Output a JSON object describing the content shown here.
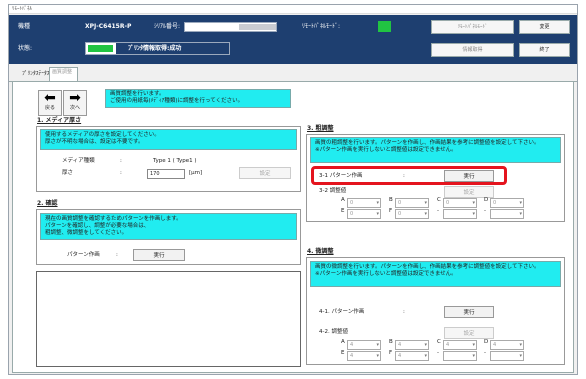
{
  "window": {
    "title": "ﾘﾓｰﾄﾊﾟﾈﾙ"
  },
  "header": {
    "model_label": "機種",
    "model_value": "XPJ-C6415R-P",
    "serial_label": "ｼﾘｱﾙ番号:",
    "remote_label": "ﾘﾓｰﾄﾊﾟﾈﾙﾓｰﾄﾞ:",
    "status_label": "状態:",
    "status_value": "ﾌﾟﾘﾝﾀ情報取得:成功",
    "remote_mode_button": "ﾘﾓｰﾄﾊﾟﾈﾙﾓｰﾄﾞ",
    "change_button": "変更",
    "info_button": "情報取得",
    "exit_button": "終了"
  },
  "tabs": [
    {
      "label": "ﾌﾟﾘﾝﾀｽﾃｰﾀｽ"
    },
    {
      "label": "画質調整"
    }
  ],
  "intro": {
    "line1": "画質調整を行います。",
    "line2": "ご使用の用紙毎(ﾒﾃﾞｨｱ種類)に調整を行ってください。"
  },
  "nav": {
    "back_label": "戻る",
    "next_label": "次へ"
  },
  "section1": {
    "title": "1. メディア厚さ",
    "msg1": "使用するメディアの厚さを設定してください。",
    "msg2": "厚さが不明な場合は、設定は不要です。",
    "media_label": "メディア種類",
    "colon": ":",
    "media_value": "Type 1 ( Type1 )",
    "thickness_label": "厚さ",
    "thickness_value": "170",
    "unit": "[μm]",
    "set_button": "設定"
  },
  "section2": {
    "title": "2. 確認",
    "msg1": "現在の画質調整を確認するためパターンを作画します。",
    "msg2": "パターンを確認し、調整が必要な場合は、",
    "msg3": "粗調整、微調整をしてください。",
    "pattern_label": "パターン作画",
    "colon": ":",
    "exec_button": "実行"
  },
  "section3": {
    "title": "3. 粗調整",
    "msg1": "画質の粗調整を行います。パターンを作画し、作画結果を参考に調整値を設定して下さい。",
    "msg2": "※パターン作画を実行しないと調整値は設定できません。",
    "step1_label": "3-1  パターン作画",
    "colon": ":",
    "exec_button": "実行",
    "step2_label": "3-2  調整値",
    "set_button": "設定",
    "row1": [
      {
        "letter": "A",
        "value": "0"
      },
      {
        "letter": "B",
        "value": "0"
      },
      {
        "letter": "C",
        "value": "0"
      },
      {
        "letter": "D",
        "value": "0"
      }
    ],
    "row2": [
      {
        "letter": "E",
        "value": "0"
      },
      {
        "letter": "F",
        "value": "0"
      },
      {
        "letter": "-",
        "value": ""
      },
      {
        "letter": "-",
        "value": ""
      }
    ]
  },
  "section4": {
    "title": "4. 微調整",
    "msg1": "画質の微調整を行います。パターンを作画し、作画結果を参考に調整値を設定して下さい。",
    "msg2": "※パターン作画を実行しないと調整値は設定できません。",
    "step1_label": "4-1.  パターン作画",
    "colon": ":",
    "exec_button": "実行",
    "step2_label": "4-2.  調整値",
    "set_button": "設定",
    "row1": [
      {
        "letter": "A",
        "value": "4"
      },
      {
        "letter": "B",
        "value": "4"
      },
      {
        "letter": "C",
        "value": "4"
      },
      {
        "letter": "D",
        "value": "4"
      }
    ],
    "row2": [
      {
        "letter": "E",
        "value": "4"
      },
      {
        "letter": "F",
        "value": "4"
      },
      {
        "letter": "-",
        "value": ""
      },
      {
        "letter": "-",
        "value": ""
      }
    ]
  },
  "colors": {
    "header_bg": "#1e3f70",
    "status_green": "#21c442",
    "cyan_msg": "#21ecf0",
    "highlight_red": "#e4141e"
  }
}
